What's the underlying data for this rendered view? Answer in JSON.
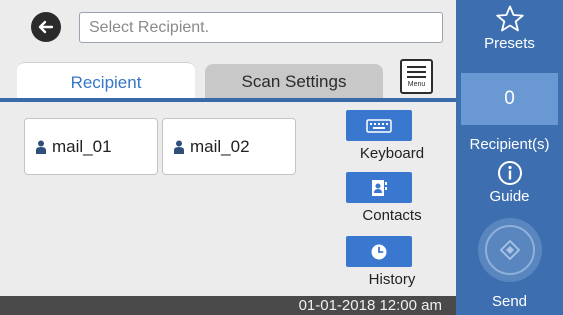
{
  "header": {
    "back_icon": "arrow-left-icon",
    "search_placeholder": "Select Recipient."
  },
  "tabs": [
    {
      "label": "Recipient",
      "active": true
    },
    {
      "label": "Scan Settings",
      "active": false
    }
  ],
  "menu_button": {
    "label": "Menu",
    "icon": "list-icon"
  },
  "recipients": [
    {
      "label": "mail_01",
      "icon": "person-icon"
    },
    {
      "label": "mail_02",
      "icon": "person-icon"
    }
  ],
  "tools": [
    {
      "label": "Keyboard",
      "icon": "keyboard-icon"
    },
    {
      "label": "Contacts",
      "icon": "contacts-icon"
    },
    {
      "label": "History",
      "icon": "clock-icon"
    }
  ],
  "status": {
    "datetime": "01-01-2018 12:00 am"
  },
  "sidebar": {
    "presets_label": "Presets",
    "presets_icon": "star-icon",
    "recipient_count": "0",
    "recipient_count_label": "Recipient(s)",
    "guide_label": "Guide",
    "guide_icon": "info-icon",
    "send_label": "Send",
    "send_icon": "diamond-icon"
  },
  "colors": {
    "accent": "#3c6eb0",
    "tile": "#3a78cf",
    "active_tab_text": "#3677c7",
    "status_bar": "#4a4a4a"
  }
}
